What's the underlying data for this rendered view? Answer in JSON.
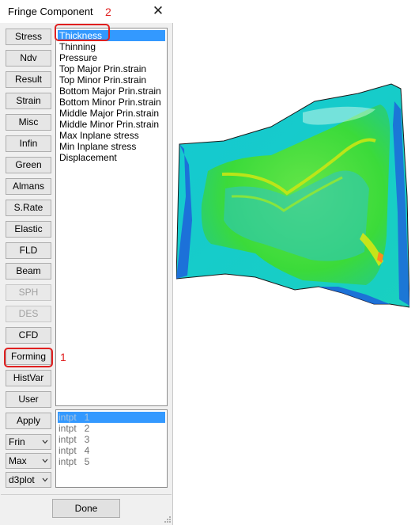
{
  "window": {
    "title": "Fringe Component",
    "close_glyph": "✕"
  },
  "buttons": [
    "Stress",
    "Ndv",
    "Result",
    "Strain",
    "Misc",
    "Infin",
    "Green",
    "Almans",
    "S.Rate",
    "Elastic",
    "FLD",
    "Beam",
    "SPH",
    "DES",
    "CFD",
    "Forming",
    "HistVar",
    "User",
    "Apply"
  ],
  "disabled_buttons": [
    "SPH",
    "DES"
  ],
  "dropdowns": [
    "Frin",
    "Max",
    "d3plot"
  ],
  "component_list": {
    "selected": "Thickness",
    "items": [
      "Thickness",
      "Thinning",
      "Pressure",
      "Top Major Prin.strain",
      "Top Minor Prin.strain",
      "Bottom Major Prin.strain",
      "Bottom Minor Prin.strain",
      "Middle Major Prin.strain",
      "Middle Minor Prin.strain",
      "Max Inplane stress",
      "Min Inplane stress",
      "Displacement"
    ]
  },
  "intpt_list": {
    "selected": "intpt   1",
    "items": [
      "intpt   1",
      "intpt   2",
      "intpt   3",
      "intpt   4",
      "intpt   5"
    ]
  },
  "done_label": "Done",
  "annotations": {
    "forming_step": "1",
    "thickness_step": "2",
    "color": "#e02020"
  },
  "colors": {
    "selection": "#3399ff",
    "fringe_cyan": "#14c8d2",
    "fringe_green": "#3fdc2a",
    "fringe_blue": "#1e5adc",
    "fringe_yellow": "#c8e614"
  }
}
